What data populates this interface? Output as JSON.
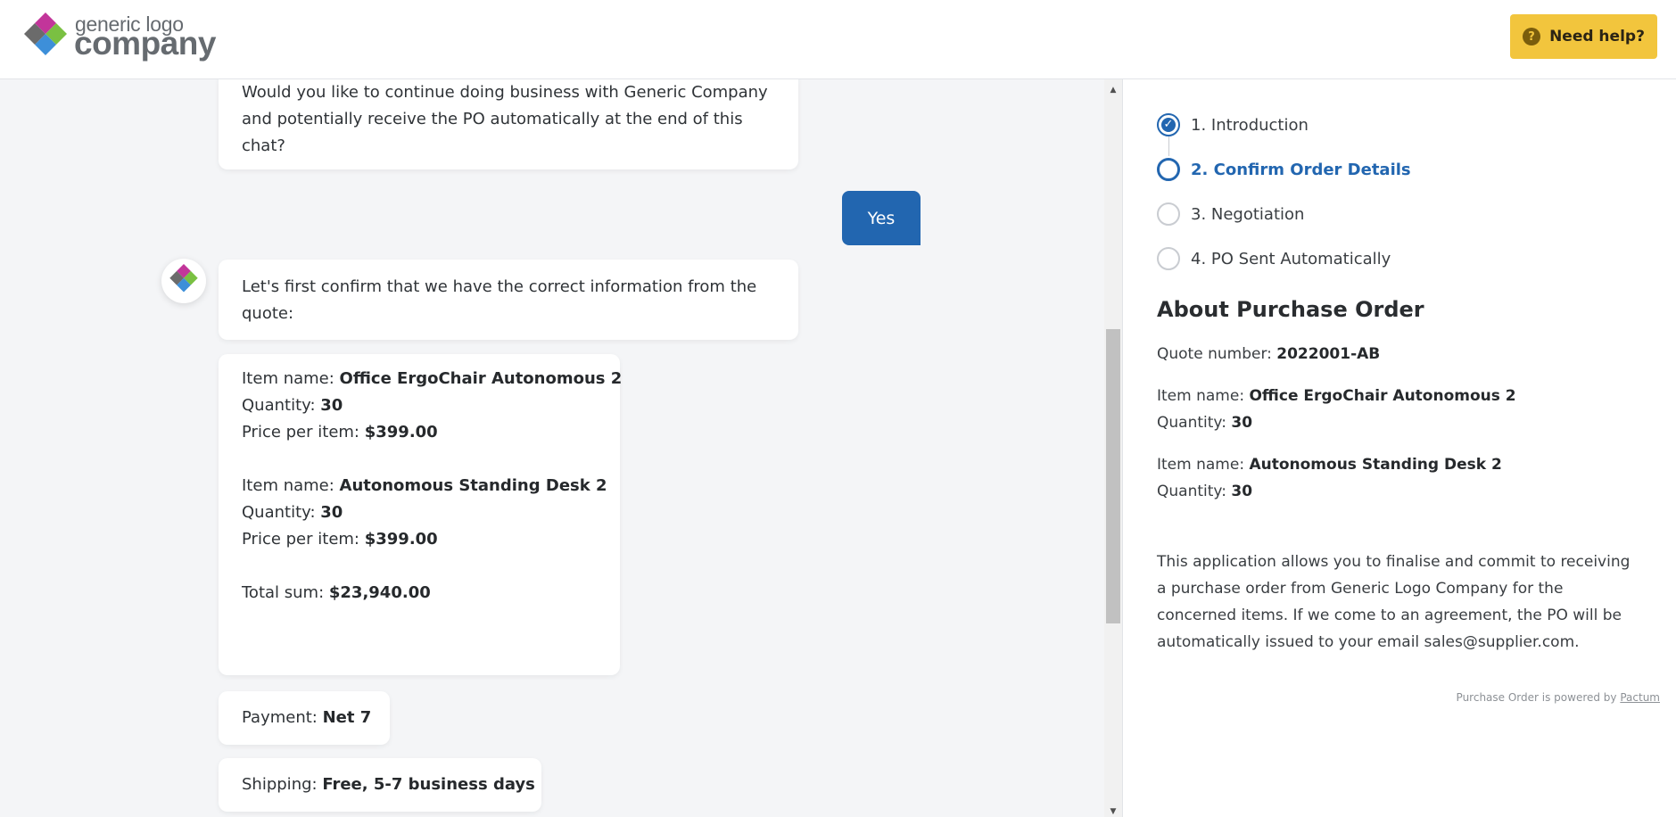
{
  "header": {
    "logo_small": "generic logo",
    "logo_big": "company",
    "help_label": "Need help?",
    "help_icon": "?"
  },
  "chat": {
    "msg_continue": [
      "Would you like to continue doing business with Generic Company",
      "and potentially receive the PO automatically at the end of this",
      "chat?"
    ],
    "yes_label": "Yes",
    "msg_confirm": [
      "Let's first confirm that we have the correct information from the",
      "quote:"
    ],
    "items": [
      {
        "name_label": "Item name: ",
        "name": "Office ErgoChair Autonomous 2",
        "qty_label": "Quantity: ",
        "qty": "30",
        "price_label": "Price per item: ",
        "price": "$399.00"
      },
      {
        "name_label": "Item name: ",
        "name": "Autonomous Standing Desk 2",
        "qty_label": "Quantity: ",
        "qty": "30",
        "price_label": "Price per item: ",
        "price": "$399.00"
      }
    ],
    "total_label": "Total sum: ",
    "total": "$23,940.00",
    "payment_label": "Payment: ",
    "payment": "Net 7",
    "shipping_label": "Shipping: ",
    "shipping": "Free, 5-7 business days"
  },
  "steps": [
    {
      "label": "1. Introduction",
      "state": "done"
    },
    {
      "label": "2. Confirm Order Details",
      "state": "active"
    },
    {
      "label": "3. Negotiation",
      "state": "pending"
    },
    {
      "label": "4. PO Sent Automatically",
      "state": "pending"
    }
  ],
  "about": {
    "title": "About Purchase Order",
    "quote_label": "Quote number: ",
    "quote_number": "2022001-AB",
    "items": [
      {
        "name_label": "Item name: ",
        "name": "Office ErgoChair Autonomous 2",
        "qty_label": "Quantity: ",
        "qty": "30"
      },
      {
        "name_label": "Item name: ",
        "name": "Autonomous Standing Desk 2",
        "qty_label": "Quantity: ",
        "qty": "30"
      }
    ],
    "description": "This application allows you to finalise and commit to receiving a purchase order from Generic Logo Company for the concerned items. If we come to an agreement, the PO will be automatically issued to your email sales@supplier.com.",
    "powered_text": "Purchase Order is powered by ",
    "powered_link": "Pactum"
  },
  "colors": {
    "accent": "#2266b0",
    "help_bg": "#f2c53d",
    "chat_bg": "#f4f5f7"
  },
  "icons": [
    "help-circle-icon",
    "check-icon",
    "logo-diamond-icon",
    "scroll-up-arrow-icon",
    "scroll-down-arrow-icon"
  ]
}
